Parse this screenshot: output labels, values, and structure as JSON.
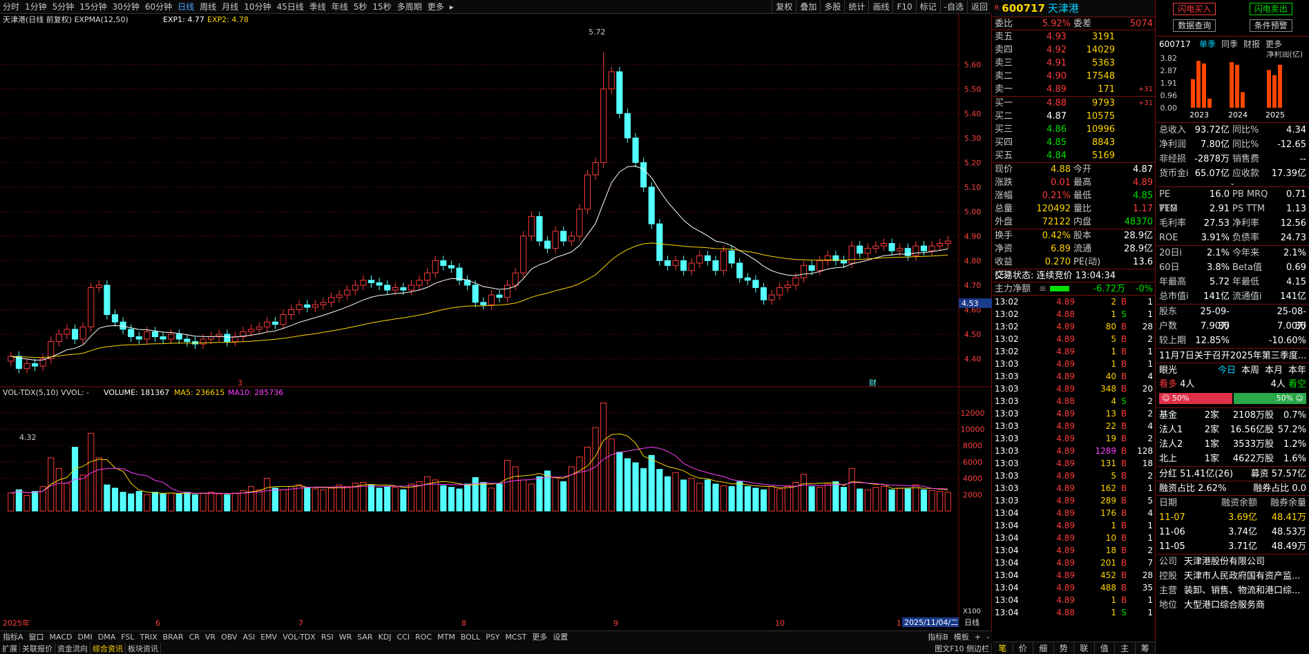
{
  "toolbar": {
    "items": [
      "分时",
      "1分钟",
      "5分钟",
      "15分钟",
      "30分钟",
      "60分钟",
      "日线",
      "周线",
      "月线",
      "10分钟",
      "45日线",
      "季线",
      "年线",
      "5秒",
      "15秒",
      "多周期",
      "更多"
    ],
    "active": "日线",
    "right": [
      "复权",
      "叠加",
      "多股",
      "统计",
      "画线",
      "F10",
      "标记",
      "-自选",
      "返回"
    ]
  },
  "chart": {
    "title": "天津港(日线 前复权)",
    "indicator": "EXPMA(12,50)",
    "exp1": "EXP1: 4.77",
    "exp2": "EXP2: 4.78",
    "high_label": "5.72",
    "low_label": "4.32",
    "price_ticks": [
      "5.60",
      "5.50",
      "5.40",
      "5.30",
      "5.20",
      "5.10",
      "5.00",
      "4.90",
      "4.80",
      "4.70",
      "4.60",
      "4.50",
      "4.40"
    ],
    "cur_price_tag": "4.53",
    "mark3": "3",
    "mark_cai": "财",
    "vol_title": "VOL-TDX(5,10)",
    "vvol": "VVOL: -",
    "volume": "VOLUME: 181367",
    "ma5": "MA5: 236615",
    "ma10": "MA10: 285736",
    "vol_ticks": [
      "12000",
      "10000",
      "8000",
      "6000",
      "4000",
      "2000"
    ],
    "vol_unit": "X100",
    "months": [
      "2025年",
      "6",
      "7",
      "8",
      "9",
      "10",
      "1"
    ],
    "date_tag": "2025/11/04/二",
    "period": "日线",
    "candles": [
      4.41,
      4.36,
      4.38,
      4.37,
      4.4,
      4.47,
      4.5,
      4.52,
      4.48,
      4.53,
      4.69,
      4.7,
      4.58,
      4.55,
      4.52,
      4.49,
      4.48,
      4.51,
      4.49,
      4.48,
      4.5,
      4.48,
      4.47,
      4.46,
      4.48,
      4.49,
      4.5,
      4.47,
      4.49,
      4.51,
      4.52,
      4.53,
      4.55,
      4.54,
      4.58,
      4.6,
      4.62,
      4.61,
      4.62,
      4.63,
      4.65,
      4.66,
      4.68,
      4.7,
      4.72,
      4.71,
      4.7,
      4.68,
      4.69,
      4.68,
      4.7,
      4.72,
      4.75,
      4.8,
      4.78,
      4.77,
      4.72,
      4.7,
      4.63,
      4.62,
      4.66,
      4.65,
      4.7,
      4.75,
      4.9,
      4.98,
      4.88,
      4.85,
      4.92,
      4.88,
      4.9,
      5.01,
      5.15,
      5.2,
      5.5,
      5.57,
      5.4,
      5.3,
      5.2,
      5.1,
      4.95,
      4.8,
      4.78,
      4.8,
      4.76,
      4.79,
      4.82,
      4.8,
      4.76,
      4.84,
      4.79,
      4.73,
      4.72,
      4.69,
      4.64,
      4.66,
      4.69,
      4.7,
      4.73,
      4.78,
      4.76,
      4.8,
      4.82,
      4.8,
      4.79,
      4.86,
      4.83,
      4.85,
      4.86,
      4.87,
      4.84,
      4.85,
      4.82,
      4.86,
      4.84,
      4.86,
      4.87,
      4.88
    ],
    "volumes": [
      2200,
      2600,
      1900,
      2400,
      3000,
      6500,
      5200,
      3400,
      7800,
      4400,
      9500,
      6500,
      3200,
      2800,
      2300,
      2100,
      2400,
      2000,
      2300,
      2100,
      2200,
      2100,
      2300,
      2000,
      2200,
      2300,
      2100,
      2000,
      2200,
      2500,
      3000,
      2600,
      4000,
      2800,
      2600,
      3000,
      3200,
      2900,
      2700,
      2600,
      2800,
      3200,
      3000,
      3400,
      3500,
      3200,
      2800,
      3000,
      2900,
      2600,
      3300,
      3600,
      4200,
      3800,
      3100,
      2900,
      2700,
      3300,
      4100,
      3500,
      2800,
      3300,
      6200,
      5400,
      3800,
      3300,
      4200,
      4900,
      4100,
      3600,
      5400,
      6600,
      7800,
      10200,
      13200,
      8800,
      7200,
      6400,
      5900,
      5200,
      6800,
      5100,
      4200,
      4700,
      3800,
      4000,
      3400,
      3800,
      3300,
      3100,
      3000,
      3600,
      3000,
      2800,
      2600,
      3000,
      2700,
      3100,
      3500,
      4500,
      3000,
      2900,
      3300,
      3600,
      2900,
      5200,
      2700,
      2600,
      2900,
      3000,
      2600,
      2800,
      2700,
      3200,
      2600,
      2500,
      2400,
      2300
    ]
  },
  "quote": {
    "code": "600717",
    "name": "天津港",
    "weibi_label": "委比",
    "weibi": "5.92%",
    "weicha_label": "委差",
    "weicha": "5074",
    "asks": [
      {
        "l": "卖五",
        "p": "4.93",
        "v": "3191",
        "d": ""
      },
      {
        "l": "卖四",
        "p": "4.92",
        "v": "14029",
        "d": ""
      },
      {
        "l": "卖三",
        "p": "4.91",
        "v": "5363",
        "d": ""
      },
      {
        "l": "卖二",
        "p": "4.90",
        "v": "17548",
        "d": ""
      },
      {
        "l": "卖一",
        "p": "4.89",
        "v": "171",
        "d": "+31"
      }
    ],
    "bids": [
      {
        "l": "买一",
        "p": "4.88",
        "v": "9793",
        "d": "+31"
      },
      {
        "l": "买二",
        "p": "4.87",
        "v": "10575",
        "d": ""
      },
      {
        "l": "买三",
        "p": "4.86",
        "v": "10996",
        "d": ""
      },
      {
        "l": "买四",
        "p": "4.85",
        "v": "8843",
        "d": ""
      },
      {
        "l": "买五",
        "p": "4.84",
        "v": "5169",
        "d": ""
      }
    ],
    "stats": [
      [
        "现价",
        "4.88",
        "今开",
        "4.87"
      ],
      [
        "涨跌",
        "0.01",
        "最高",
        "4.89"
      ],
      [
        "涨幅",
        "0.21%",
        "最低",
        "4.85"
      ],
      [
        "总量",
        "120492",
        "量比",
        "1.17"
      ],
      [
        "外盘",
        "72122",
        "内盘",
        "48370"
      ]
    ],
    "stats2": [
      [
        "换手",
        "0.42%",
        "股本",
        "28.9亿"
      ],
      [
        "净资",
        "6.89",
        "流通",
        "28.9亿"
      ],
      [
        "收益(三)",
        "0.270",
        "PE(动)",
        "13.6"
      ]
    ],
    "trade_state": "交易状态: 连续竞价 13:04:34",
    "zl_label": "主力净额",
    "zl_value": "-6.72万",
    "zl_pct": "-0%",
    "ticks": [
      [
        "13:02",
        "4.89",
        "2",
        "B",
        "1"
      ],
      [
        "13:02",
        "4.88",
        "1",
        "S",
        "1"
      ],
      [
        "13:02",
        "4.89",
        "80",
        "B",
        "28"
      ],
      [
        "13:02",
        "4.89",
        "5",
        "B",
        "2"
      ],
      [
        "13:02",
        "4.89",
        "1",
        "B",
        "1"
      ],
      [
        "13:03",
        "4.89",
        "1",
        "B",
        "1"
      ],
      [
        "13:03",
        "4.89",
        "40",
        "B",
        "4"
      ],
      [
        "13:03",
        "4.89",
        "348",
        "B",
        "20"
      ],
      [
        "13:03",
        "4.88",
        "4",
        "S",
        "2"
      ],
      [
        "13:03",
        "4.89",
        "13",
        "B",
        "2"
      ],
      [
        "13:03",
        "4.89",
        "22",
        "B",
        "4"
      ],
      [
        "13:03",
        "4.89",
        "19",
        "B",
        "2"
      ],
      [
        "13:03",
        "4.89",
        "1289",
        "B",
        "128"
      ],
      [
        "13:03",
        "4.89",
        "131",
        "B",
        "18"
      ],
      [
        "13:03",
        "4.89",
        "5",
        "B",
        "2"
      ],
      [
        "13:03",
        "4.89",
        "162",
        "B",
        "1"
      ],
      [
        "13:03",
        "4.89",
        "289",
        "B",
        "5"
      ],
      [
        "13:04",
        "4.89",
        "176",
        "B",
        "4"
      ],
      [
        "13:04",
        "4.89",
        "1",
        "B",
        "1"
      ],
      [
        "13:04",
        "4.89",
        "10",
        "B",
        "1"
      ],
      [
        "13:04",
        "4.89",
        "18",
        "B",
        "2"
      ],
      [
        "13:04",
        "4.89",
        "201",
        "B",
        "7"
      ],
      [
        "13:04",
        "4.89",
        "452",
        "B",
        "28"
      ],
      [
        "13:04",
        "4.89",
        "488",
        "B",
        "35"
      ],
      [
        "13:04",
        "4.89",
        "1",
        "B",
        "1"
      ],
      [
        "13:04",
        "4.88",
        "1",
        "S",
        "1"
      ]
    ],
    "bottom_tabs": [
      "笔",
      "价",
      "细",
      "势",
      "联",
      "值",
      "主",
      "筹"
    ]
  },
  "fund": {
    "btn1": "闪电买入",
    "btn2": "闪电卖出",
    "btn3": "数据查询",
    "btn4": "条件预警",
    "code": "600717",
    "tabs": [
      "单季",
      "同季",
      "财报",
      "更多"
    ],
    "unit": "净利润(亿)",
    "yticks": [
      "3.82",
      "2.87",
      "1.91",
      "0.96",
      "0.00"
    ],
    "years": [
      "2023",
      "2024",
      "2025"
    ],
    "bars": [
      2.2,
      3.6,
      3.4,
      0.7,
      3.5,
      3.3,
      1.2,
      2.9,
      2.5,
      3.3
    ],
    "rows1": [
      [
        "总收入",
        "93.72亿",
        "同比%",
        "4.34"
      ],
      [
        "净利润",
        "7.80亿",
        "同比%",
        "-12.65"
      ],
      [
        "非经损",
        "-2878万",
        "销售费",
        "--"
      ],
      [
        "货币金i",
        "65.07亿",
        "应收款",
        "17.39亿"
      ]
    ],
    "rows2": [
      [
        "PE TTM",
        "16.0",
        "PB MRQ",
        "0.71"
      ],
      [
        "PEG",
        "2.91",
        "PS TTM",
        "1.13"
      ],
      [
        "毛利率",
        "27.53",
        "净利率",
        "12.56"
      ],
      [
        "ROE",
        "3.91%",
        "负债率",
        "24.73"
      ]
    ],
    "rows3": [
      [
        "20日i",
        "2.1%",
        "今年来",
        "2.1%"
      ],
      [
        "60日",
        "3.8%",
        "Beta值",
        "0.69"
      ],
      [
        "年最高",
        "5.72",
        "年最低",
        "4.15"
      ],
      [
        "总市值i",
        "141亿",
        "流通值i",
        "141亿"
      ]
    ],
    "rows4": [
      [
        "股东",
        "25-09-30",
        "",
        "25-08-30"
      ],
      [
        "户数",
        "7.90万",
        "",
        "7.00万"
      ],
      [
        "较上期",
        "12.85%",
        "",
        "-10.60%"
      ]
    ],
    "notice": "11月7日关于召开2025年第三季度...",
    "eye": "眼光",
    "eye_tabs": [
      "今日",
      "本周",
      "本月",
      "本年"
    ],
    "bull": "看多",
    "bull_n": "4人",
    "bear": "看空",
    "bear_n": "4人",
    "bull_pct": "50%",
    "bear_pct": "50%",
    "holders": [
      [
        "基金",
        "2家",
        "2108万股",
        "0.7%"
      ],
      [
        "法人1",
        "2家",
        "16.56亿股",
        "57.2%"
      ],
      [
        "法人2",
        "1家",
        "3533万股",
        "1.2%"
      ],
      [
        "北上",
        "1家",
        "4622万股",
        "1.6%"
      ]
    ],
    "fenhong": "分红 51.41亿(26)",
    "muzi": "募资 57.57亿",
    "rzzb": "融资占比 2.62%",
    "rqzb": "融券占比 0.0",
    "margin_head": [
      "日期",
      "融资余额",
      "融券余量"
    ],
    "margin": [
      [
        "11-07",
        "3.69亿",
        "48.41万"
      ],
      [
        "11-06",
        "3.74亿",
        "48.53万"
      ],
      [
        "11-05",
        "3.71亿",
        "48.49万"
      ]
    ],
    "company": [
      [
        "公司",
        "天津港股份有限公司"
      ],
      [
        "控股",
        "天津市人民政府国有资产监..."
      ],
      [
        "主营",
        "装卸、销售、物流和港口综..."
      ],
      [
        "地位",
        "大型港口综合服务商"
      ]
    ]
  },
  "bottom1": [
    "指标A",
    "窗口",
    "MACD",
    "DMI",
    "DMA",
    "FSL",
    "TRIX",
    "BRAR",
    "CR",
    "VR",
    "OBV",
    "ASI",
    "EMV",
    "VOL-TDX",
    "RSI",
    "WR",
    "SAR",
    "KDJ",
    "CCI",
    "ROC",
    "MTM",
    "BOLL",
    "PSY",
    "MCST",
    "更多",
    "设置"
  ],
  "bottom1_right": [
    "指标B",
    "模板",
    "+",
    "-"
  ],
  "bottom2": [
    "扩展",
    "关联报价",
    "资金流向",
    "综合资讯",
    "板块资讯"
  ],
  "bottom2_right": "图文F10 侧边栏"
}
